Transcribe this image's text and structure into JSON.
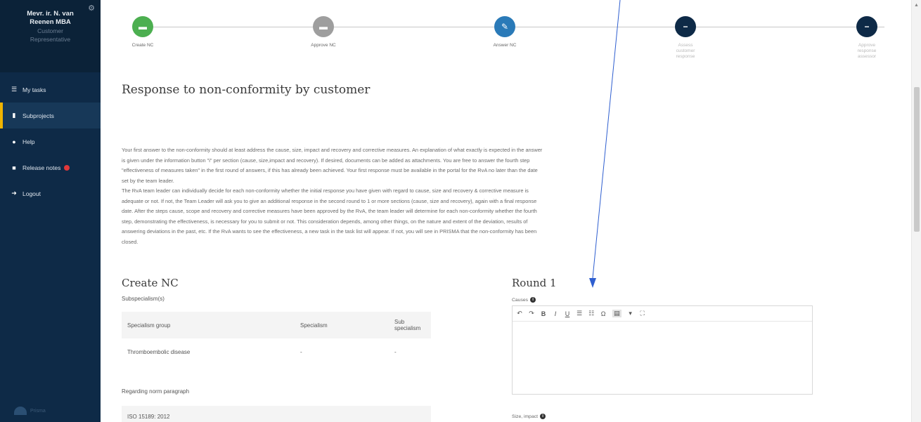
{
  "user": {
    "name_line1": "Mevr. ir. N. van",
    "name_line2": "Reenen MBA",
    "role_line1": "Customer",
    "role_line2": "Representative"
  },
  "sidebar": {
    "items": [
      {
        "label": "My tasks",
        "icon": "list-icon"
      },
      {
        "label": "Subprojects",
        "icon": "document-icon"
      },
      {
        "label": "Help",
        "icon": "info-icon"
      },
      {
        "label": "Release notes",
        "icon": "notes-icon"
      },
      {
        "label": "Logout",
        "icon": "logout-icon"
      }
    ],
    "logo_text": "Prisma"
  },
  "stepper": {
    "steps": [
      {
        "label": "Create NC",
        "color": "#4caf50",
        "icon": "lock-icon"
      },
      {
        "label": "Approve NC",
        "color": "#9e9e9e",
        "icon": "lock-icon"
      },
      {
        "label": "Answer NC",
        "color": "#2a7ab8",
        "icon": "pencil-icon"
      },
      {
        "label_l1": "Assess",
        "label_l2": "customer",
        "label_l3": "response",
        "color": "#0e2a47",
        "icon": "minus-icon"
      },
      {
        "label_l1": "Approve",
        "label_l2": "response",
        "label_l3": "assessor",
        "color": "#0e2a47",
        "icon": "minus-icon"
      }
    ]
  },
  "page": {
    "title": "Response to non-conformity by customer",
    "intro": [
      "Your first answer to the non-conformity should at least address the cause, size, impact and recovery and corrective measures. An explanation of what exactly is expected in the answer",
      "is given under the information button \"i\" per section (cause, size,impact and recovery). If desired, documents can be added as attachments. You are free to answer the fourth step",
      "\"effectiveness of measures taken\" in the first round of answers, if this has already been achieved. Your first response must be available in the portal for the RvA no later than the date",
      "set by the team leader.",
      "The RvA team leader can individually decide for each non-conformity whether the initial response you have given with regard to cause, size and recovery & corrective measure is",
      "adequate or not. If not, the Team Leader will ask you to give an additional response in the second round to 1 or more sections (cause, size and recovery), again with a final response",
      "date. After the steps cause, scope and recovery and corrective measures have been approved by the RvA, the team leader will determine for each non-conformity whether the fourth",
      "step, demonstrating the effectiveness, is necessary for you to submit or not. This consideration depends, among other things, on the nature and extent of the deviation, results of",
      "answering deviations in the past, etc. If the RvA wants to see the effectiveness, a new task in the task list will appear. If not, you will see in PRISMA that the non-conformity has been",
      "closed."
    ]
  },
  "create_nc": {
    "title": "Create NC",
    "subspecialism_label": "Subspecialism(s)",
    "table_headers": [
      "Specialism group",
      "Specialism",
      "Sub specialism"
    ],
    "table_rows": [
      [
        "Thromboembolic disease",
        "-",
        "-"
      ]
    ],
    "norm_label": "Regarding norm paragraph",
    "norm_value": "ISO 15189: 2012"
  },
  "round": {
    "title": "Round 1",
    "cause_label": "Causes",
    "size_label": "Size, impact",
    "toolbar": {
      "undo": "↶",
      "redo": "↷",
      "bold": "B",
      "italic": "I",
      "underline": "U",
      "ordered_list": "☰",
      "bullet_list": "☷",
      "special_char": "Ω",
      "highlight": "▤",
      "dropdown": "▾",
      "fullscreen": "⛶"
    }
  },
  "colors": {
    "sidebar": "#0e2a47",
    "accent": "#f0b400",
    "annotation": "#2f5fd0"
  }
}
